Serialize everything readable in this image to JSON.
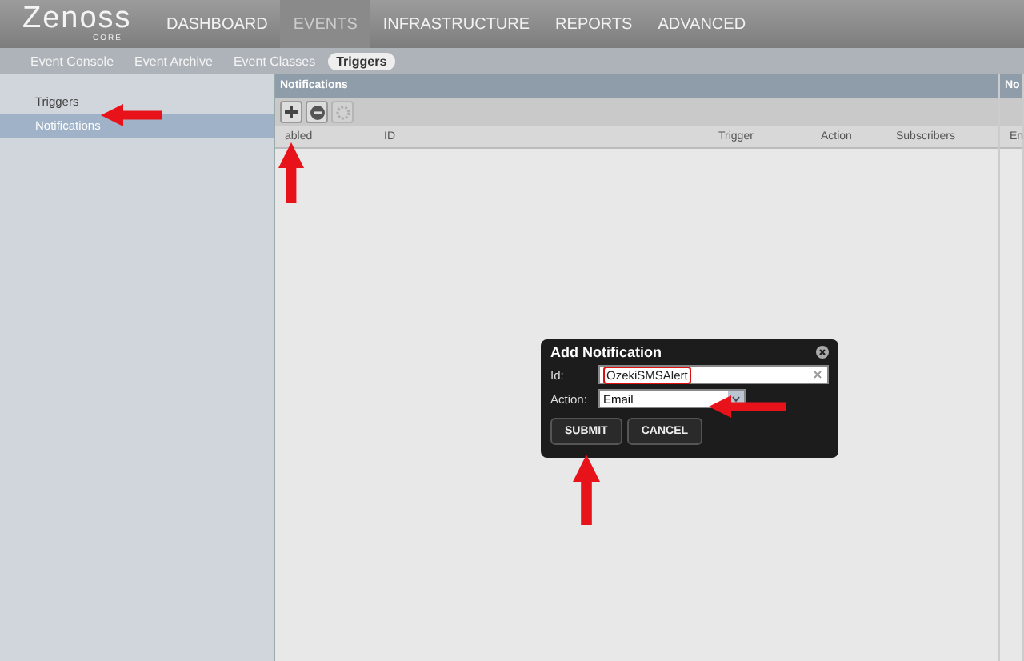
{
  "logo": {
    "name": "Zenoss",
    "edition": "CORE"
  },
  "nav": [
    {
      "label": "DASHBOARD",
      "selected": false
    },
    {
      "label": "EVENTS",
      "selected": true
    },
    {
      "label": "INFRASTRUCTURE",
      "selected": false
    },
    {
      "label": "REPORTS",
      "selected": false
    },
    {
      "label": "ADVANCED",
      "selected": false
    }
  ],
  "subnav": [
    {
      "label": "Event Console",
      "selected": false
    },
    {
      "label": "Event Archive",
      "selected": false
    },
    {
      "label": "Event Classes",
      "selected": false
    },
    {
      "label": "Triggers",
      "selected": true
    }
  ],
  "sidebar": {
    "items": [
      {
        "label": "Triggers",
        "selected": false
      },
      {
        "label": "Notifications",
        "selected": true
      }
    ]
  },
  "panel": {
    "title": "Notifications",
    "toolbar": [
      {
        "kind": "add",
        "disabled": false
      },
      {
        "kind": "remove",
        "disabled": false
      },
      {
        "kind": "settings",
        "disabled": true
      }
    ],
    "columns": [
      "abled",
      "ID",
      "Trigger",
      "Action",
      "Subscribers"
    ]
  },
  "side_panel": {
    "title": "No",
    "columns": [
      "En"
    ]
  },
  "dialog": {
    "title": "Add Notification",
    "fields": [
      {
        "kind": "text",
        "label": "Id:",
        "value": "OzekiSMSAlert"
      },
      {
        "kind": "select",
        "label": "Action:",
        "value": "Email"
      }
    ],
    "buttons": [
      "SUBMIT",
      "CANCEL"
    ]
  }
}
